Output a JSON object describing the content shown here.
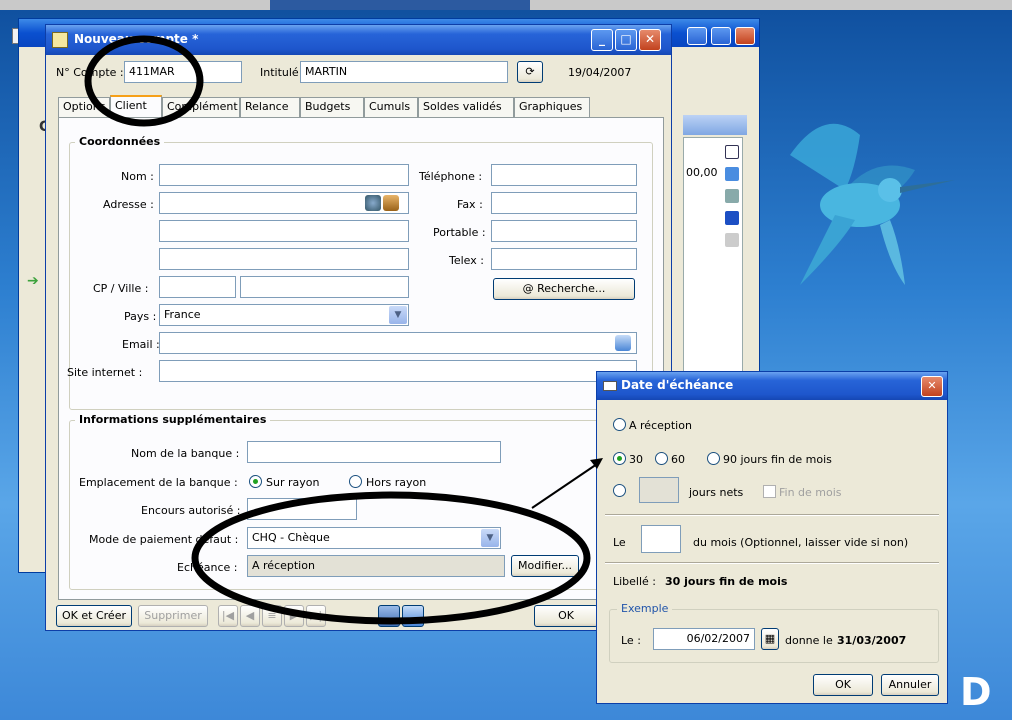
{
  "main_window": {
    "title": "Nouveau compte *",
    "compte_label": "N° Compte :",
    "compte_value": "411MAR",
    "intitule_label": "Intitulé :",
    "intitule_value": "MARTIN",
    "date": "19/04/2007",
    "tabs": [
      "Options",
      "Client",
      "Complément",
      "Relance",
      "Budgets",
      "Cumuls",
      "Soldes validés",
      "Graphiques"
    ],
    "active_tab": "Client",
    "coordonnees": {
      "title": "Coordonnées",
      "nom_label": "Nom :",
      "adresse_label": "Adresse :",
      "cp_ville_label": "CP / Ville :",
      "pays_label": "Pays :",
      "pays_value": "France",
      "email_label": "Email :",
      "site_label": "Site internet :",
      "telephone_label": "Téléphone :",
      "fax_label": "Fax :",
      "portable_label": "Portable :",
      "telex_label": "Telex :",
      "recherche_button": "@ Recherche..."
    },
    "infos": {
      "title": "Informations supplémentaires",
      "banque_label": "Nom de la banque :",
      "emplacement_label": "Emplacement de la banque :",
      "sur_rayon": "Sur rayon",
      "hors_rayon": "Hors rayon",
      "encours_label": "Encours autorisé :",
      "mode_label": "Mode de paiement défaut :",
      "mode_value": "CHQ - Chèque",
      "echeance_label": "Echéance :",
      "echeance_value": "A réception",
      "modifier_button": "Modifier..."
    },
    "bottom": {
      "ok_creer": "OK et Créer",
      "supprimer": "Supprimer",
      "ok": "OK"
    }
  },
  "back_window": {
    "cell_value": "00,00",
    "c_label": "C"
  },
  "dialog": {
    "title": "Date d'échéance",
    "a_reception": "A réception",
    "opt_30": "30",
    "opt_60": "60",
    "opt_90": "90 jours fin de mois",
    "jours_nets": "jours nets",
    "fin_de_mois": "Fin de mois",
    "le_label": "Le",
    "du_mois_text": "du mois (Optionnel, laisser vide si non)",
    "libelle_label": "Libellé :",
    "libelle_value": "30 jours fin de mois",
    "exemple_title": "Exemple",
    "exemple_le": "Le :",
    "exemple_date": "06/02/2007",
    "donne_le": "donne le",
    "result_date": "31/03/2007",
    "ok": "OK",
    "annuler": "Annuler"
  },
  "colors": {
    "xp_blue": "#0a50d0",
    "window_bg": "#ece9d8",
    "annotation": "#000000"
  }
}
